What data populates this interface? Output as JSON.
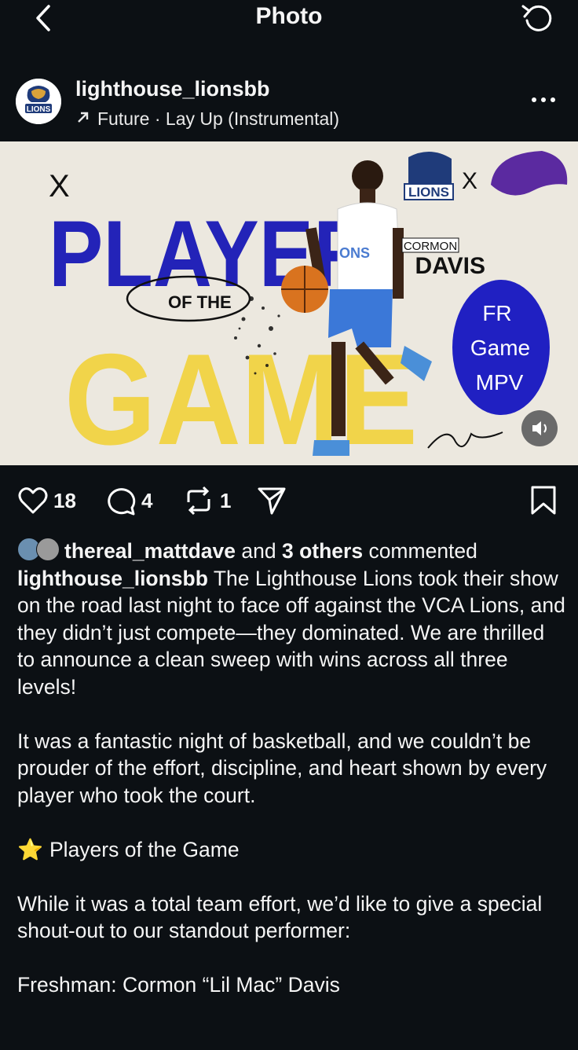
{
  "topbar": {
    "title": "Photo"
  },
  "post": {
    "username": "lighthouse_lionsbb",
    "audio": "Future · Lay Up (Instrumental)",
    "image": {
      "headline_1": "PLAYER",
      "headline_of": "OF THE",
      "headline_2": "GAME",
      "logo_text": "LIONS",
      "versus": "X",
      "name_first": "CORMON",
      "name_last": "DAVIS",
      "badge_line1": "FR",
      "badge_line2": "Game",
      "badge_line3": "MPV",
      "jersey_text": "ONS",
      "avatar_text": "LIONS"
    },
    "stats": {
      "likes": "18",
      "comments": "4",
      "reposts": "1"
    },
    "commenters": {
      "user": "thereal_mattdave",
      "and": "and",
      "others": "3 others",
      "verb": "commented"
    },
    "caption": {
      "p1": "The Lighthouse Lions took their show on the road last night to face off against the VCA Lions, and they didn’t just compete—they dominated. We are thrilled to announce a clean sweep with wins across all three levels!",
      "p2": "It was a fantastic night of basketball, and we couldn’t be prouder of the effort, discipline, and heart shown by every player who took the court.",
      "p3_emoji": "⭐",
      "p3": "Players of the Game",
      "p4": "While it was a total team effort, we’d like to give a special shout-out to our standout performer:",
      "p5": "Freshman: Cormon “Lil Mac” Davis"
    }
  },
  "colors": {
    "background": "#0c1014",
    "blue": "#2323b8",
    "yellow": "#f2d23a",
    "purple": "#5b2aa0"
  },
  "icons": [
    "back-icon",
    "refresh-icon",
    "more-icon",
    "heart-icon",
    "comment-icon",
    "repost-icon",
    "share-icon",
    "bookmark-icon",
    "audio-arrow-icon",
    "volume-icon",
    "star-icon"
  ]
}
